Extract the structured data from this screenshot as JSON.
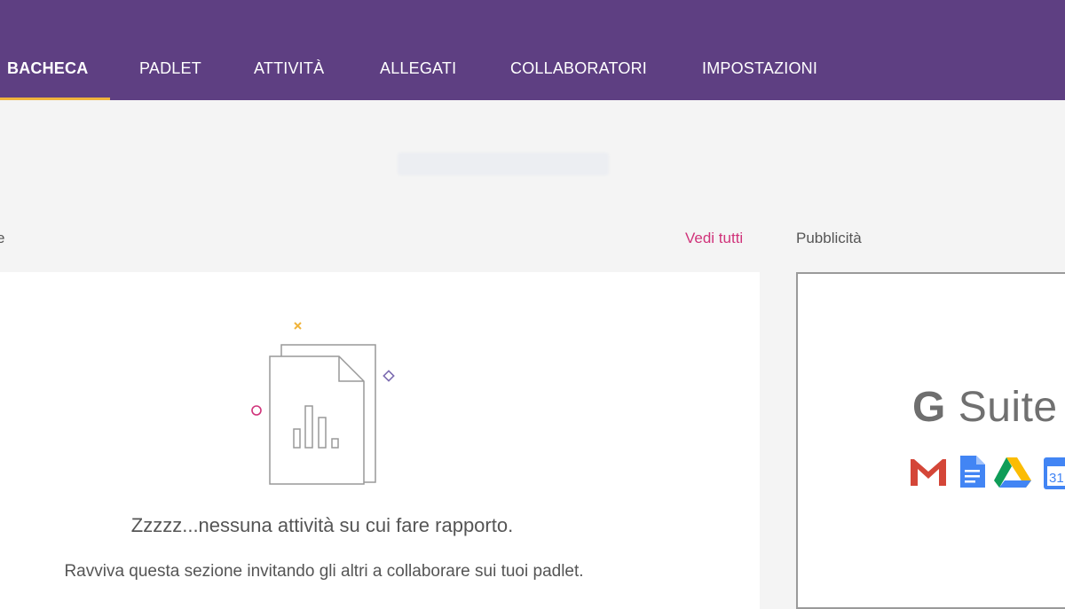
{
  "nav": {
    "tabs": [
      {
        "label": "BACHECA",
        "active": true
      },
      {
        "label": "PADLET",
        "active": false
      },
      {
        "label": "ATTIVITÀ",
        "active": false
      },
      {
        "label": "ALLEGATI",
        "active": false
      },
      {
        "label": "COLLABORATORI",
        "active": false
      },
      {
        "label": "IMPOSTAZIONI",
        "active": false
      }
    ]
  },
  "activity": {
    "section_title": "e",
    "see_all": "Vedi tutti",
    "empty_title": "Zzzzz...nessuna attività su cui fare rapporto.",
    "empty_subtitle": "Ravviva questa sezione invitando gli altri a collaborare sui tuoi padlet."
  },
  "ads": {
    "title": "Pubblicità",
    "logo_g": "G",
    "logo_text": "Suite",
    "calendar_number": "31"
  },
  "colors": {
    "topbar": "#5e3f82",
    "accent": "#f0b43c",
    "link": "#d0337a"
  }
}
